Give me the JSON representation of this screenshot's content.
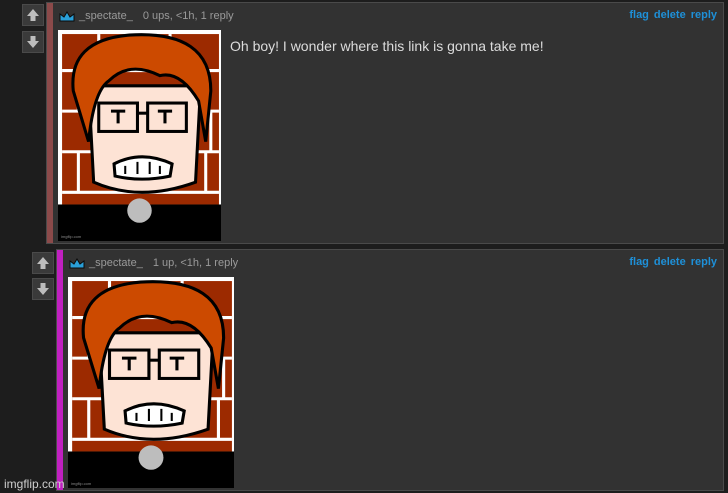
{
  "comments": [
    {
      "username": "_spectate_",
      "meta": "0 ups, <1h, 1 reply",
      "text": "Oh boy! I wonder where this link is gonna take me!",
      "links": {
        "flag": "flag",
        "delete": "delete",
        "reply": "reply"
      },
      "bar_color": "#8b4a4a",
      "image_watermark": "imgflip.com"
    },
    {
      "username": "_spectate_",
      "meta": "1 up, <1h, 1 reply",
      "links": {
        "flag": "flag",
        "delete": "delete",
        "reply": "reply"
      },
      "bar_color": "#c020c0",
      "image_watermark": "imgflip.com"
    }
  ],
  "icons": {
    "upvote": "up-arrow-icon",
    "downvote": "down-arrow-icon",
    "badge": "crown-icon"
  },
  "footer_watermark": "imgflip.com",
  "colors": {
    "link": "#1e90d8",
    "crown": "#2a9fd8",
    "meme_brick": "#9c2a00",
    "hair": "#cc4a00"
  }
}
